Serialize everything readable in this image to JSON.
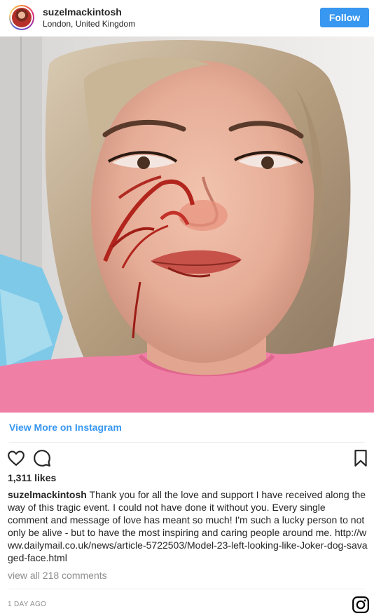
{
  "header": {
    "username": "suzelmackintosh",
    "location": "London, United Kingdom",
    "follow_label": "Follow"
  },
  "photo": {
    "description_icon": "post-photo"
  },
  "links": {
    "view_more_label": "View More on Instagram"
  },
  "actions": {
    "like_icon": "heart-icon",
    "comment_icon": "comment-icon",
    "save_icon": "bookmark-icon"
  },
  "post": {
    "likes": "1,311 likes",
    "caption_user": "suzelmackintosh",
    "caption_text": "Thank you for all the love and support I have received along the way of this tragic event. I could not have done it without you. Every single comment and message of love has meant so much! I'm such a lucky person to not only be alive - but to have the most inspiring and caring people around me.",
    "caption_link": "http://www.dailymail.co.uk/news/article-5722503/Model-23-left-looking-like-Joker-dog-savaged-face.html",
    "view_comments": "view all 218 comments",
    "time": "1 DAY AGO"
  },
  "footer": {
    "instagram_icon": "instagram-logo-icon"
  },
  "colors": {
    "accent": "#3897f0",
    "text": "#262626",
    "muted": "#8e8e8e",
    "divider": "#efefef"
  }
}
